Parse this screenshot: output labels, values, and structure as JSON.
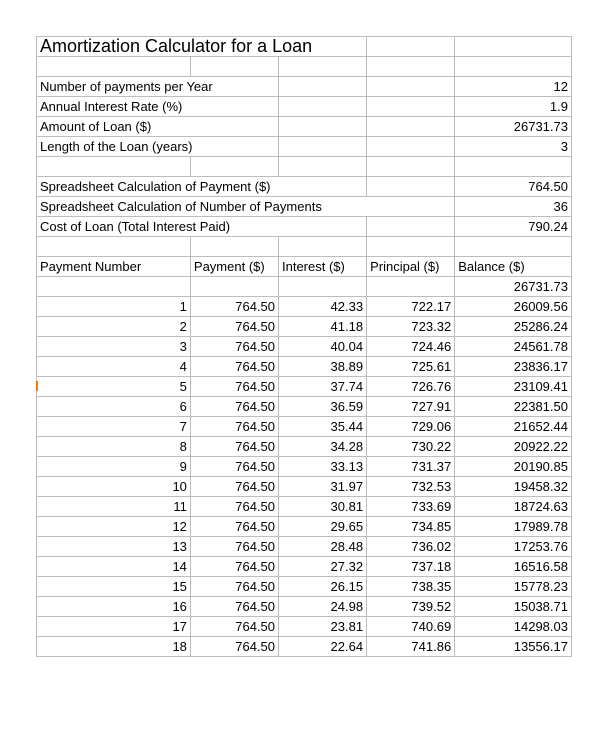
{
  "title": "Amortization Calculator for a Loan",
  "labels": {
    "num_payments_year": "Number of payments per Year",
    "annual_rate": "Annual Interest Rate (%)",
    "amount": "Amount of Loan ($)",
    "length_years": "Length of the Loan (years)",
    "calc_payment": "Spreadsheet Calculation of Payment ($)",
    "calc_num_payments": "Spreadsheet Calculation of Number of Payments",
    "cost": "Cost of Loan (Total Interest Paid)"
  },
  "inputs": {
    "num_payments_year": "12",
    "annual_rate": "1.9",
    "amount": "26731.73",
    "length_years": "3"
  },
  "calc": {
    "payment": "764.50",
    "num_payments": "36",
    "cost": "790.24"
  },
  "headers": {
    "pn": "Payment Number",
    "pay": "Payment ($)",
    "int": "Interest ($)",
    "prin": "Principal ($)",
    "bal": "Balance ($)"
  },
  "start_balance": "26731.73",
  "rows": [
    {
      "pn": "1",
      "pay": "764.50",
      "int": "42.33",
      "prin": "722.17",
      "bal": "26009.56"
    },
    {
      "pn": "2",
      "pay": "764.50",
      "int": "41.18",
      "prin": "723.32",
      "bal": "25286.24"
    },
    {
      "pn": "3",
      "pay": "764.50",
      "int": "40.04",
      "prin": "724.46",
      "bal": "24561.78"
    },
    {
      "pn": "4",
      "pay": "764.50",
      "int": "38.89",
      "prin": "725.61",
      "bal": "23836.17"
    },
    {
      "pn": "5",
      "pay": "764.50",
      "int": "37.74",
      "prin": "726.76",
      "bal": "23109.41"
    },
    {
      "pn": "6",
      "pay": "764.50",
      "int": "36.59",
      "prin": "727.91",
      "bal": "22381.50"
    },
    {
      "pn": "7",
      "pay": "764.50",
      "int": "35.44",
      "prin": "729.06",
      "bal": "21652.44"
    },
    {
      "pn": "8",
      "pay": "764.50",
      "int": "34.28",
      "prin": "730.22",
      "bal": "20922.22"
    },
    {
      "pn": "9",
      "pay": "764.50",
      "int": "33.13",
      "prin": "731.37",
      "bal": "20190.85"
    },
    {
      "pn": "10",
      "pay": "764.50",
      "int": "31.97",
      "prin": "732.53",
      "bal": "19458.32"
    },
    {
      "pn": "11",
      "pay": "764.50",
      "int": "30.81",
      "prin": "733.69",
      "bal": "18724.63"
    },
    {
      "pn": "12",
      "pay": "764.50",
      "int": "29.65",
      "prin": "734.85",
      "bal": "17989.78"
    },
    {
      "pn": "13",
      "pay": "764.50",
      "int": "28.48",
      "prin": "736.02",
      "bal": "17253.76"
    },
    {
      "pn": "14",
      "pay": "764.50",
      "int": "27.32",
      "prin": "737.18",
      "bal": "16516.58"
    },
    {
      "pn": "15",
      "pay": "764.50",
      "int": "26.15",
      "prin": "738.35",
      "bal": "15778.23"
    },
    {
      "pn": "16",
      "pay": "764.50",
      "int": "24.98",
      "prin": "739.52",
      "bal": "15038.71"
    },
    {
      "pn": "17",
      "pay": "764.50",
      "int": "23.81",
      "prin": "740.69",
      "bal": "14298.03"
    },
    {
      "pn": "18",
      "pay": "764.50",
      "int": "22.64",
      "prin": "741.86",
      "bal": "13556.17"
    }
  ]
}
